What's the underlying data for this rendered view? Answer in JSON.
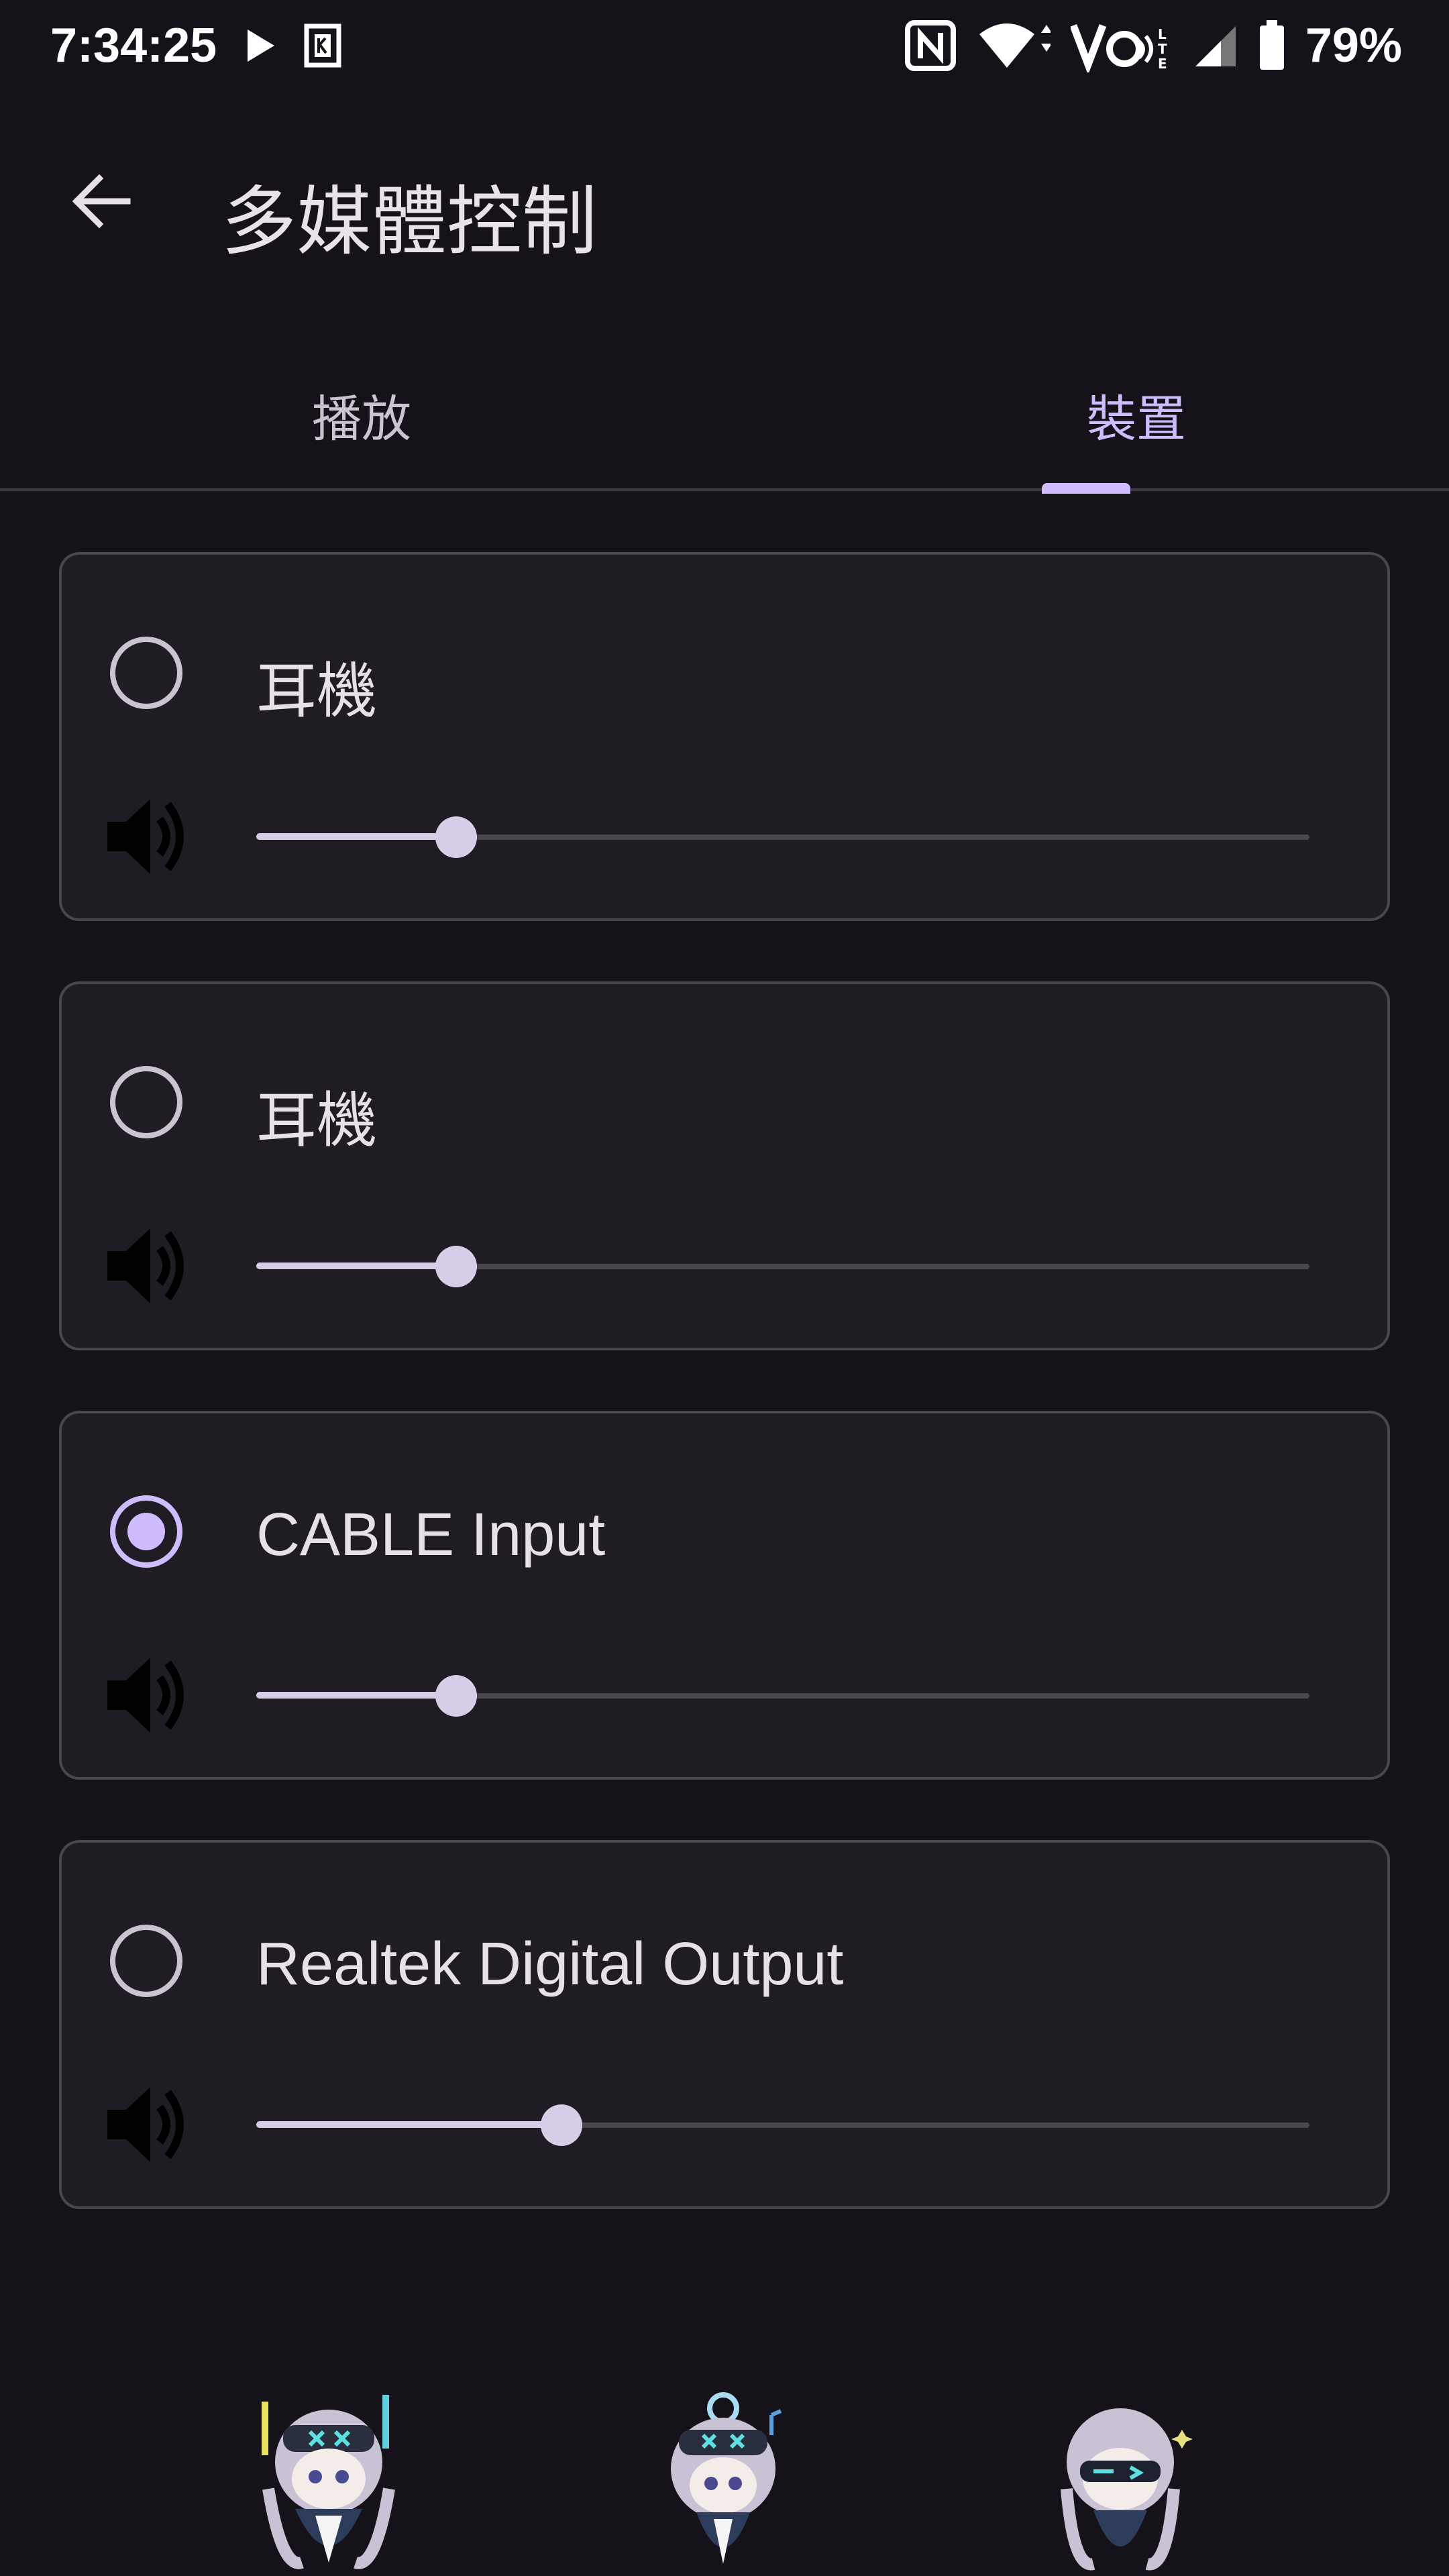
{
  "status_bar": {
    "time": "7:34:25",
    "battery": "79%",
    "icons": [
      "play-icon",
      "k-app-icon",
      "nfc-icon",
      "wifi-icon",
      "volte-icon",
      "signal-icon",
      "battery-icon"
    ]
  },
  "app_bar": {
    "title": "多媒體控制",
    "back_icon": "arrow-back-icon"
  },
  "tabs": [
    {
      "label": "播放",
      "selected": false
    },
    {
      "label": "裝置",
      "selected": true
    }
  ],
  "devices": [
    {
      "name": "耳機",
      "selected": false,
      "volume": 0.19
    },
    {
      "name": "耳機",
      "selected": false,
      "volume": 0.19
    },
    {
      "name": "CABLE Input",
      "selected": true,
      "volume": 0.19
    },
    {
      "name": "Realtek Digital Output",
      "selected": false,
      "volume": 0.29
    }
  ],
  "colors": {
    "background": "#15121a",
    "accent": "#cfbcff",
    "card": "#1f1d23",
    "card_border": "#4a4650"
  }
}
